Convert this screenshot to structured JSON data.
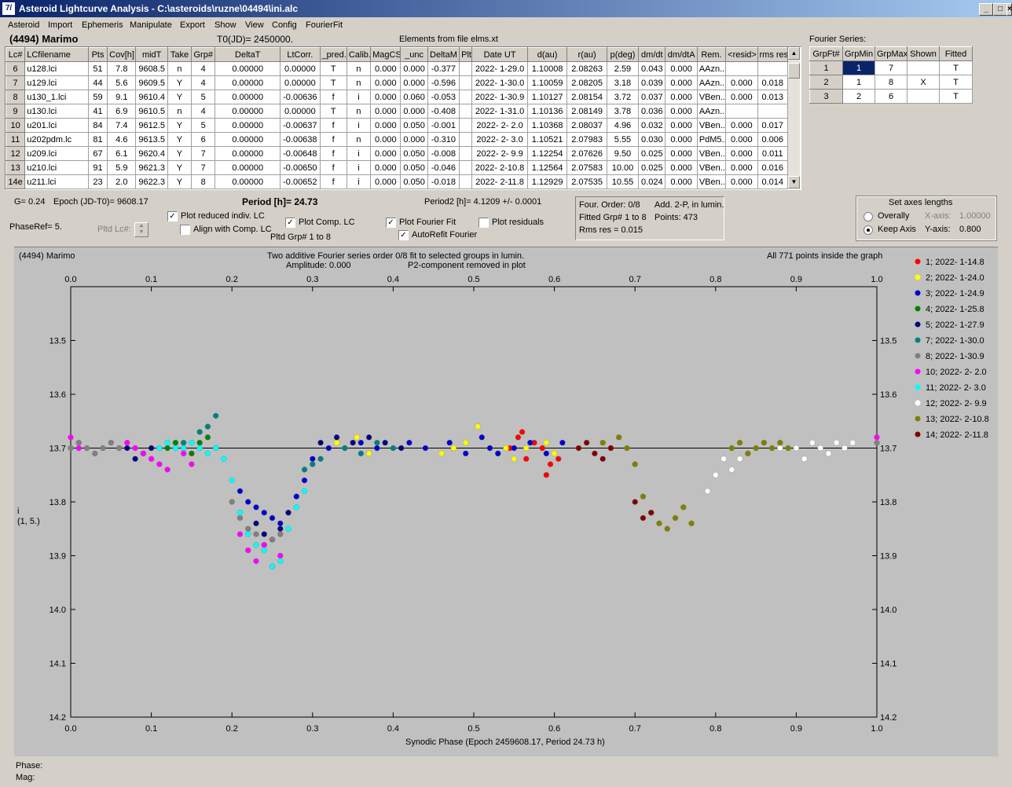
{
  "window": {
    "title": "Asteroid Lightcurve Analysis - C:\\asteroids\\ruzne\\04494\\ini.alc",
    "icon": "7/"
  },
  "menu": [
    "Asteroid",
    "Import",
    "Ephemeris",
    "Manipulate",
    "Export",
    "Show",
    "View",
    "Config",
    "FourierFit"
  ],
  "header": {
    "asteroid": "(4494) Marimo",
    "t0": "T0(JD)= 2450000.",
    "elements": "Elements from file elms.xt"
  },
  "lc_table": {
    "columns": [
      "Lc#",
      "LCfilename",
      "Pts",
      "Cov[h]",
      "midT",
      "Take",
      "Grp#",
      "DeltaT",
      "LtCorr.",
      "_pred.",
      "Calib.",
      "MagCS",
      "_unc",
      "DeltaM",
      "Plt",
      "Date UT",
      "d(au)",
      "r(au)",
      "p(deg)",
      "dm/dt",
      "dm/dtA",
      "Rem.",
      "<resid>",
      "rms res"
    ],
    "rows": [
      [
        "6",
        "u128.lci",
        "51",
        "7.8",
        "9608.5",
        "n",
        "4",
        "0.00000",
        "0.00000",
        "T",
        "n",
        "0.000",
        "0.000",
        "-0.377",
        "",
        "2022- 1-29.0",
        "1.10008",
        "2.08263",
        "2.59",
        "0.043",
        "0.000",
        "AAzn...",
        "",
        ""
      ],
      [
        "7",
        "u129.lci",
        "44",
        "5.6",
        "9609.5",
        "Y",
        "4",
        "0.00000",
        "0.00000",
        "T",
        "n",
        "0.000",
        "0.000",
        "-0.596",
        "",
        "2022- 1-30.0",
        "1.10059",
        "2.08205",
        "3.18",
        "0.039",
        "0.000",
        "AAzn...",
        "0.000",
        "0.018"
      ],
      [
        "8",
        "u130_1.lci",
        "59",
        "9.1",
        "9610.4",
        "Y",
        "5",
        "0.00000",
        "-0.00636",
        "f",
        "i",
        "0.000",
        "0.060",
        "-0.053",
        "",
        "2022- 1-30.9",
        "1.10127",
        "2.08154",
        "3.72",
        "0.037",
        "0.000",
        "VBen...",
        "0.000",
        "0.013"
      ],
      [
        "9",
        "u130.lci",
        "41",
        "6.9",
        "9610.5",
        "n",
        "4",
        "0.00000",
        "0.00000",
        "T",
        "n",
        "0.000",
        "0.000",
        "-0.408",
        "",
        "2022- 1-31.0",
        "1.10136",
        "2.08149",
        "3.78",
        "0.036",
        "0.000",
        "AAzn...",
        "",
        ""
      ],
      [
        "10",
        "u201.lci",
        "84",
        "7.4",
        "9612.5",
        "Y",
        "5",
        "0.00000",
        "-0.00637",
        "f",
        "i",
        "0.000",
        "0.050",
        "-0.001",
        "",
        "2022- 2- 2.0",
        "1.10368",
        "2.08037",
        "4.96",
        "0.032",
        "0.000",
        "VBen...",
        "0.000",
        "0.017"
      ],
      [
        "11",
        "u202pdm.lc",
        "81",
        "4.6",
        "9613.5",
        "Y",
        "6",
        "0.00000",
        "-0.00638",
        "f",
        "n",
        "0.000",
        "0.000",
        "-0.310",
        "",
        "2022- 2- 3.0",
        "1.10521",
        "2.07983",
        "5.55",
        "0.030",
        "0.000",
        "PdM5...",
        "0.000",
        "0.006"
      ],
      [
        "12",
        "u209.lci",
        "67",
        "6.1",
        "9620.4",
        "Y",
        "7",
        "0.00000",
        "-0.00648",
        "f",
        "i",
        "0.000",
        "0.050",
        "-0.008",
        "",
        "2022- 2- 9.9",
        "1.12254",
        "2.07626",
        "9.50",
        "0.025",
        "0.000",
        "VBen...",
        "0.000",
        "0.011"
      ],
      [
        "13",
        "u210.lci",
        "91",
        "5.9",
        "9621.3",
        "Y",
        "7",
        "0.00000",
        "-0.00650",
        "f",
        "i",
        "0.000",
        "0.050",
        "-0.046",
        "",
        "2022- 2-10.8",
        "1.12564",
        "2.07583",
        "10.00",
        "0.025",
        "0.000",
        "VBen...",
        "0.000",
        "0.016"
      ],
      [
        "14e",
        "u211.lci",
        "23",
        "2.0",
        "9622.3",
        "Y",
        "8",
        "0.00000",
        "-0.00652",
        "f",
        "i",
        "0.000",
        "0.050",
        "-0.018",
        "",
        "2022- 2-11.8",
        "1.12929",
        "2.07535",
        "10.55",
        "0.024",
        "0.000",
        "VBen...",
        "0.000",
        "0.014"
      ]
    ]
  },
  "fourier_table": {
    "title": "Fourier Series:",
    "columns": [
      "GrpFt#",
      "GrpMin",
      "GrpMax",
      "Shown",
      "Fitted"
    ],
    "rows": [
      [
        "1",
        "1",
        "7",
        "",
        "T"
      ],
      [
        "2",
        "1",
        "8",
        "X",
        "T"
      ],
      [
        "3",
        "2",
        "6",
        "",
        "T"
      ]
    ]
  },
  "info": {
    "g": "G= 0.24",
    "epoch": "Epoch (JD-T0)= 9608.17",
    "period": "Period [h]= 24.73",
    "period2": "Period2 [h]= 4.1209 +/- 0.0001",
    "phaseref": "PhaseRef= 5.",
    "pltd_lc": "Pltd Lc#:",
    "pltd_grp": "Pltd Grp#  1   to   8"
  },
  "checks": {
    "plot_reduced": "Plot reduced indiv. LC",
    "align_comp": "Align with Comp. LC",
    "plot_comp": "Plot Comp. LC",
    "plot_fourier": "Plot Fourier Fit",
    "autorefit": "AutoRefit Fourier",
    "plot_resid": "Plot residuals"
  },
  "fourier_info": {
    "order": "Four. Order:  0/8",
    "add": "Add. 2-P, in lumin.",
    "fitted": "Fitted Grp# 1 to 8",
    "points": "Points: 473",
    "rms": "Rms res      = 0.015"
  },
  "axes_box": {
    "title": "Set axes lengths",
    "overally": "Overally",
    "keep": "Keep Axis",
    "xaxis": "X-axis:",
    "xval": "1.00000",
    "yaxis": "Y-axis:",
    "yval": "0.800"
  },
  "plot": {
    "name": "(4494) Marimo",
    "line1": "Two additive Fourier series order 0/8 fit to selected groups in lumin.",
    "line2": "Amplitude: 0.000",
    "line3": "P2-component removed in plot",
    "inside": "All 771 points inside the graph",
    "xlabel": "Synodic Phase (Epoch 2459608.17, Period 24.73 h)",
    "ylabel1": "i",
    "ylabel2": "(1, 5.)"
  },
  "status": {
    "phase": "Phase:",
    "mag": "Mag:"
  },
  "chart_data": {
    "type": "scatter",
    "xlim": [
      0,
      1
    ],
    "ylim": [
      14.2,
      13.4
    ],
    "xticks": [
      "0.0",
      "0.1",
      "0.2",
      "0.3",
      "0.4",
      "0.5",
      "0.6",
      "0.7",
      "0.8",
      "0.9",
      "1.0"
    ],
    "yticks": [
      "13.5",
      "13.6",
      "13.7",
      "13.8",
      "13.9",
      "14.0",
      "14.1",
      "14.2"
    ],
    "reference_line": 13.7,
    "legend_position": "right",
    "series": [
      {
        "name": "1; 2022- 1-14.8",
        "color": "#ff0000",
        "points": [
          [
            0.545,
            13.7
          ],
          [
            0.555,
            13.68
          ],
          [
            0.565,
            13.72
          ],
          [
            0.575,
            13.69
          ],
          [
            0.585,
            13.7
          ],
          [
            0.595,
            13.73
          ],
          [
            0.605,
            13.72
          ],
          [
            0.56,
            13.67
          ],
          [
            0.59,
            13.75
          ]
        ]
      },
      {
        "name": "2; 2022- 1-24.0",
        "color": "#ffff00",
        "points": [
          [
            0.33,
            13.69
          ],
          [
            0.34,
            13.7
          ],
          [
            0.355,
            13.68
          ],
          [
            0.37,
            13.71
          ],
          [
            0.46,
            13.71
          ],
          [
            0.475,
            13.7
          ],
          [
            0.49,
            13.69
          ],
          [
            0.505,
            13.66
          ],
          [
            0.52,
            13.7
          ],
          [
            0.53,
            13.71
          ],
          [
            0.54,
            13.7
          ],
          [
            0.55,
            13.72
          ],
          [
            0.565,
            13.7
          ],
          [
            0.59,
            13.69
          ],
          [
            0.6,
            13.71
          ]
        ]
      },
      {
        "name": "3; 2022- 1-24.9",
        "color": "#0000cc",
        "points": [
          [
            0.21,
            13.78
          ],
          [
            0.22,
            13.8
          ],
          [
            0.23,
            13.81
          ],
          [
            0.24,
            13.82
          ],
          [
            0.25,
            13.83
          ],
          [
            0.26,
            13.84
          ],
          [
            0.27,
            13.82
          ],
          [
            0.28,
            13.79
          ],
          [
            0.29,
            13.76
          ],
          [
            0.3,
            13.72
          ],
          [
            0.32,
            13.7
          ],
          [
            0.36,
            13.69
          ],
          [
            0.38,
            13.7
          ],
          [
            0.42,
            13.69
          ],
          [
            0.44,
            13.7
          ],
          [
            0.47,
            13.69
          ],
          [
            0.49,
            13.71
          ],
          [
            0.51,
            13.68
          ],
          [
            0.52,
            13.7
          ],
          [
            0.53,
            13.71
          ],
          [
            0.55,
            13.7
          ],
          [
            0.57,
            13.69
          ],
          [
            0.59,
            13.71
          ],
          [
            0.61,
            13.69
          ]
        ]
      },
      {
        "name": "4; 2022- 1-25.8",
        "color": "#008000",
        "points": [
          [
            0.12,
            13.7
          ],
          [
            0.13,
            13.69
          ],
          [
            0.14,
            13.7
          ],
          [
            0.15,
            13.71
          ],
          [
            0.16,
            13.69
          ],
          [
            0.17,
            13.68
          ],
          [
            0.18,
            13.7
          ]
        ]
      },
      {
        "name": "5; 2022- 1-27.9",
        "color": "#000080",
        "points": [
          [
            0.07,
            13.7
          ],
          [
            0.08,
            13.72
          ],
          [
            0.09,
            13.71
          ],
          [
            0.1,
            13.7
          ],
          [
            0.23,
            13.84
          ],
          [
            0.24,
            13.86
          ],
          [
            0.25,
            13.87
          ],
          [
            0.26,
            13.85
          ],
          [
            0.27,
            13.82
          ],
          [
            0.31,
            13.69
          ],
          [
            0.33,
            13.68
          ],
          [
            0.35,
            13.69
          ],
          [
            0.37,
            13.68
          ],
          [
            0.39,
            13.69
          ],
          [
            0.41,
            13.7
          ]
        ]
      },
      {
        "name": "7; 2022- 1-30.0",
        "color": "#008080",
        "points": [
          [
            0.14,
            13.69
          ],
          [
            0.16,
            13.67
          ],
          [
            0.17,
            13.66
          ],
          [
            0.18,
            13.64
          ],
          [
            0.29,
            13.74
          ],
          [
            0.3,
            13.73
          ],
          [
            0.31,
            13.72
          ],
          [
            0.34,
            13.7
          ],
          [
            0.36,
            13.71
          ],
          [
            0.38,
            13.69
          ],
          [
            0.4,
            13.7
          ]
        ]
      },
      {
        "name": "8; 2022- 1-30.9",
        "color": "#808080",
        "points": [
          [
            0.0,
            13.7
          ],
          [
            0.01,
            13.69
          ],
          [
            0.02,
            13.7
          ],
          [
            0.03,
            13.71
          ],
          [
            0.04,
            13.7
          ],
          [
            0.05,
            13.69
          ],
          [
            0.06,
            13.7
          ],
          [
            0.2,
            13.8
          ],
          [
            0.21,
            13.83
          ],
          [
            0.22,
            13.85
          ],
          [
            0.23,
            13.86
          ],
          [
            0.24,
            13.88
          ],
          [
            0.25,
            13.87
          ],
          [
            0.26,
            13.86
          ],
          [
            1.0,
            13.69
          ]
        ]
      },
      {
        "name": "10; 2022- 2- 2.0",
        "color": "#ff00ff",
        "points": [
          [
            0.0,
            13.68
          ],
          [
            0.01,
            13.7
          ],
          [
            0.07,
            13.69
          ],
          [
            0.08,
            13.7
          ],
          [
            0.09,
            13.71
          ],
          [
            0.1,
            13.72
          ],
          [
            0.11,
            13.73
          ],
          [
            0.12,
            13.74
          ],
          [
            0.14,
            13.71
          ],
          [
            0.15,
            13.73
          ],
          [
            0.21,
            13.86
          ],
          [
            0.22,
            13.89
          ],
          [
            0.23,
            13.91
          ],
          [
            0.24,
            13.88
          ],
          [
            0.25,
            13.92
          ],
          [
            0.26,
            13.9
          ],
          [
            1.0,
            13.68
          ]
        ]
      },
      {
        "name": "11; 2022- 2- 3.0",
        "color": "#00ffff",
        "points": [
          [
            0.11,
            13.7
          ],
          [
            0.12,
            13.69
          ],
          [
            0.13,
            13.7
          ],
          [
            0.14,
            13.7
          ],
          [
            0.15,
            13.69
          ],
          [
            0.16,
            13.7
          ],
          [
            0.17,
            13.71
          ],
          [
            0.18,
            13.7
          ],
          [
            0.19,
            13.72
          ],
          [
            0.2,
            13.76
          ],
          [
            0.21,
            13.82
          ],
          [
            0.22,
            13.86
          ],
          [
            0.23,
            13.88
          ],
          [
            0.24,
            13.89
          ],
          [
            0.25,
            13.92
          ],
          [
            0.26,
            13.91
          ],
          [
            0.27,
            13.85
          ],
          [
            0.28,
            13.81
          ],
          [
            0.29,
            13.78
          ]
        ]
      },
      {
        "name": "12; 2022- 2- 9.9",
        "color": "#ffffff",
        "points": [
          [
            0.81,
            13.72
          ],
          [
            0.82,
            13.74
          ],
          [
            0.83,
            13.72
          ],
          [
            0.84,
            13.71
          ],
          [
            0.88,
            13.7
          ],
          [
            0.9,
            13.7
          ],
          [
            0.91,
            13.72
          ],
          [
            0.92,
            13.69
          ],
          [
            0.93,
            13.7
          ],
          [
            0.94,
            13.71
          ],
          [
            0.95,
            13.69
          ],
          [
            0.96,
            13.7
          ],
          [
            0.97,
            13.69
          ],
          [
            0.79,
            13.78
          ],
          [
            0.8,
            13.75
          ]
        ]
      },
      {
        "name": "13; 2022- 2-10.8",
        "color": "#808000",
        "points": [
          [
            0.66,
            13.69
          ],
          [
            0.67,
            13.7
          ],
          [
            0.68,
            13.68
          ],
          [
            0.69,
            13.7
          ],
          [
            0.7,
            13.73
          ],
          [
            0.71,
            13.79
          ],
          [
            0.72,
            13.82
          ],
          [
            0.73,
            13.84
          ],
          [
            0.74,
            13.85
          ],
          [
            0.75,
            13.83
          ],
          [
            0.76,
            13.81
          ],
          [
            0.77,
            13.84
          ],
          [
            0.82,
            13.7
          ],
          [
            0.83,
            13.69
          ],
          [
            0.84,
            13.71
          ],
          [
            0.85,
            13.7
          ],
          [
            0.86,
            13.69
          ],
          [
            0.87,
            13.7
          ],
          [
            0.88,
            13.69
          ],
          [
            0.89,
            13.7
          ]
        ]
      },
      {
        "name": "14; 2022- 2-11.8",
        "color": "#800000",
        "points": [
          [
            0.63,
            13.7
          ],
          [
            0.64,
            13.69
          ],
          [
            0.65,
            13.71
          ],
          [
            0.66,
            13.72
          ],
          [
            0.67,
            13.7
          ],
          [
            0.7,
            13.8
          ],
          [
            0.71,
            13.83
          ],
          [
            0.72,
            13.82
          ]
        ]
      }
    ]
  }
}
